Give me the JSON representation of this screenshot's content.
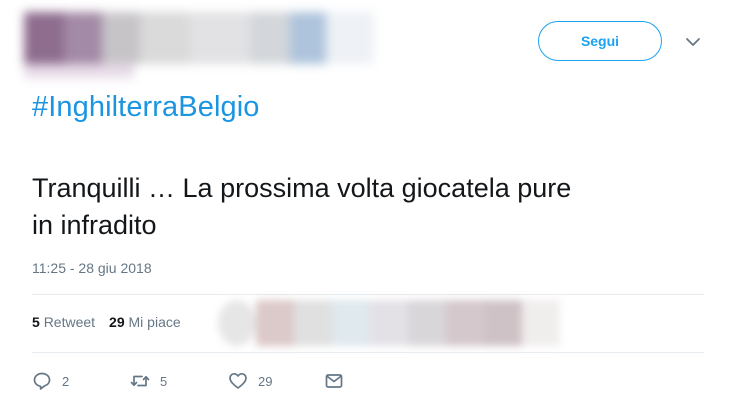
{
  "header": {
    "follow_label": "Segui",
    "author_blurred": true
  },
  "tweet": {
    "hashtag": "#InghilterraBelgio",
    "text_line1": "Tranquilli … La prossima volta giocatela pure",
    "text_line2": "in infradito",
    "timestamp": "11:25 - 28 giu 2018"
  },
  "stats": {
    "retweets_count": "5",
    "retweets_label": "Retweet",
    "likes_count": "29",
    "likes_label": "Mi piace"
  },
  "actions": {
    "reply_count": "2",
    "retweet_count": "5",
    "like_count": "29"
  },
  "colors": {
    "accent": "#1da1f2",
    "hashtag": "#1b95e0",
    "muted": "#657786"
  },
  "icons": [
    "chevron-down-icon",
    "reply-icon",
    "retweet-icon",
    "heart-icon",
    "mail-icon"
  ]
}
